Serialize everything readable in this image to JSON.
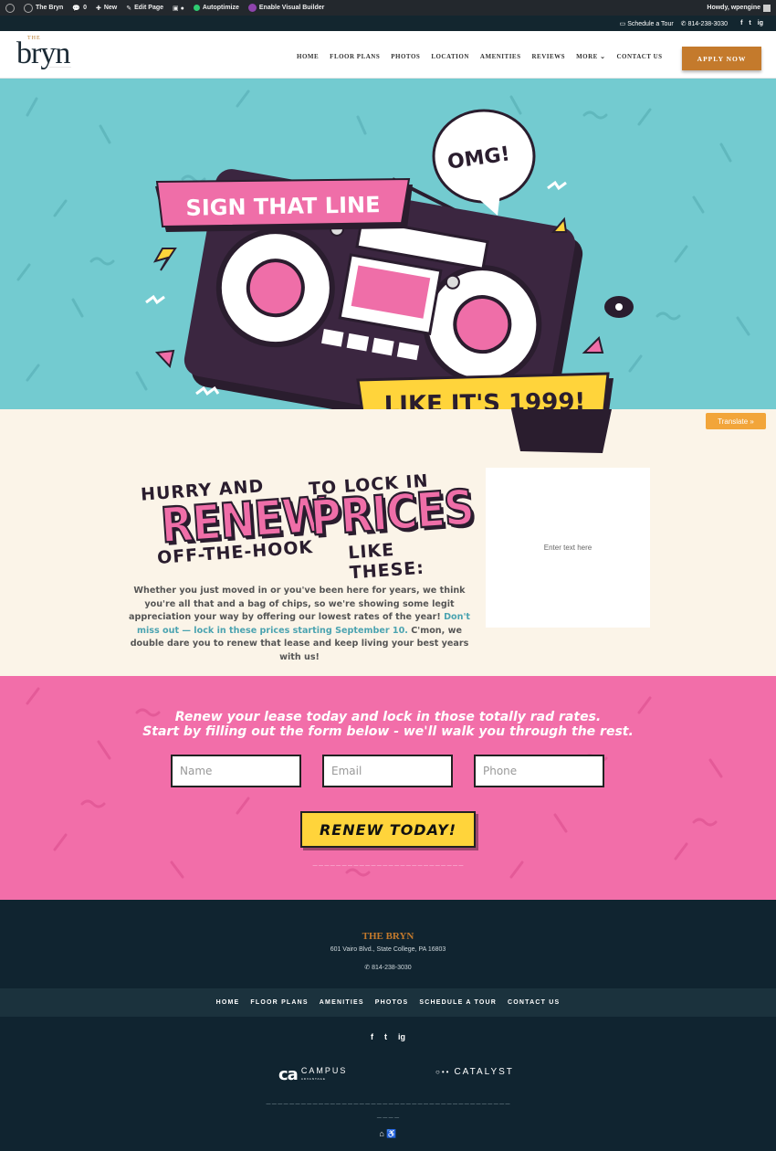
{
  "admin_bar": {
    "site": "The Bryn",
    "comments": "0",
    "new": "New",
    "edit": "Edit Page",
    "autoptimize": "Autoptimize",
    "visual_builder": "Enable Visual Builder",
    "howdy": "Howdy, wpengine"
  },
  "topbar": {
    "tour": "Schedule a Tour",
    "phone": "814-238-3030",
    "social": [
      "f",
      "t",
      "ig"
    ]
  },
  "logo": {
    "the": "THE",
    "name": "bryn"
  },
  "nav": [
    "HOME",
    "FLOOR PLANS",
    "PHOTOS",
    "LOCATION",
    "AMENITIES",
    "REVIEWS",
    "MORE ⌄",
    "CONTACT US"
  ],
  "apply": "APPLY NOW",
  "hero": {
    "banner_top": "SIGN THAT LINE",
    "bubble": "OMG!",
    "banner_bottom": "LIKE IT'S 1999!"
  },
  "translate": "Translate »",
  "promo": {
    "hurry": "HURRY AND",
    "to_lock": "TO LOCK IN",
    "renew": "RENEW",
    "prices": "PRICES",
    "off_hook": "OFF-THE-HOOK",
    "like_these": "LIKE THESE:",
    "para_a": "Whether you just moved in or you've been here for years, we think you're all that and a bag of chips, so we're showing some legit appreciation your way by offering our lowest rates of the year! ",
    "para_link": "Don't miss out — lock in these prices starting September 10.",
    "para_b": " C'mon, we double dare you to renew that lease and keep living your best years with us!",
    "textbox": "Enter text here"
  },
  "form": {
    "heading_1": "Renew your lease today and lock in those totally rad rates.",
    "heading_2": "Start by filling out the form below - we'll walk you through the rest.",
    "name_ph": "Name",
    "email_ph": "Email",
    "phone_ph": "Phone",
    "submit": "RENEW TODAY!"
  },
  "footer": {
    "brand": "THE BRYN",
    "address": "601 Vairo Blvd., State College, PA 16803",
    "phone": "814-238-3030",
    "nav": [
      "HOME",
      "FLOOR PLANS",
      "AMENITIES",
      "PHOTOS",
      "SCHEDULE A TOUR",
      "CONTACT US"
    ],
    "social": [
      "f",
      "t",
      "ig"
    ],
    "campus_ca": "ca",
    "campus_name": "CAMPUS",
    "campus_sub": "ADVANTAGE",
    "catalyst": "CATALYST"
  },
  "colors": {
    "teal": "#73cbd0",
    "pink": "#f26ea9",
    "yellow": "#ffd43b",
    "navy": "#102430",
    "gold": "#c47a2c"
  }
}
